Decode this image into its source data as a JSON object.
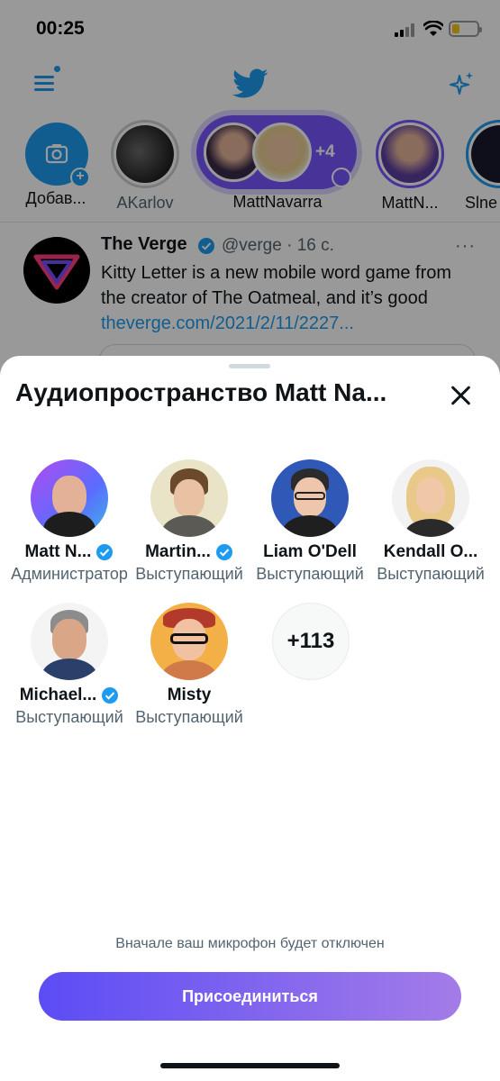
{
  "status_bar": {
    "time": "00:25"
  },
  "fleets": [
    {
      "label": "Добав..."
    },
    {
      "label": "AKarlov"
    },
    {
      "label": "MattNavarra",
      "extra": "+4"
    },
    {
      "label": "MattN..."
    },
    {
      "label": "Slne"
    }
  ],
  "tweet": {
    "name": "The Verge",
    "handle": "@verge · 16 с.",
    "text": "Kitty Letter is a new mobile word game from the creator of The Oatmeal, and it’s good ",
    "link": "theverge.com/2021/2/11/2227..."
  },
  "sheet": {
    "title": "Аудиопространство Matt Na...",
    "participants": [
      {
        "name": "Matt N...",
        "role": "Администратор",
        "verified": true
      },
      {
        "name": "Martin...",
        "role": "Выступающий",
        "verified": true
      },
      {
        "name": "Liam O'Dell",
        "role": "Выступающий",
        "verified": false
      },
      {
        "name": "Kendall O...",
        "role": "Выступающий",
        "verified": false
      },
      {
        "name": "Michael...",
        "role": "Выступающий",
        "verified": true
      },
      {
        "name": "Misty",
        "role": "Выступающий",
        "verified": false
      }
    ],
    "more_count": "+113",
    "mic_note": "Вначале ваш микрофон будет отключен",
    "join_label": "Присоединиться"
  },
  "colors": {
    "accent": "#1d9bf0",
    "join_start": "#5b4cf5",
    "join_end": "#a47ce8"
  }
}
